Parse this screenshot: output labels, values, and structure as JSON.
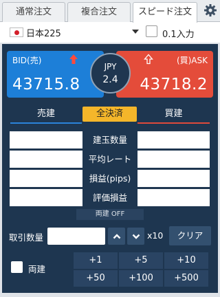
{
  "tabs": [
    {
      "label": "通常注文"
    },
    {
      "label": "複合注文"
    },
    {
      "label": "スピード注文"
    }
  ],
  "settings_icon": "gear-icon",
  "symbol": {
    "flag_icon": "japan-flag-icon",
    "name": "日本225",
    "lot_label": "0.1入力"
  },
  "quote": {
    "bid_label": "BID(売)",
    "bid_price": "43715.8",
    "ask_label": "(買)ASK",
    "ask_price": "43718.2",
    "spread_currency": "JPY",
    "spread_value": "2.4",
    "bid_color": "#1d7fd8",
    "ask_color": "#e44c3a"
  },
  "position": {
    "sell_header": "売建",
    "close_all_label": "全決済",
    "buy_header": "買建",
    "rows": [
      {
        "label": "建玉数量"
      },
      {
        "label": "平均レート"
      },
      {
        "label": "損益(pips)"
      },
      {
        "label": "評価損益"
      }
    ],
    "hedge_status": "両建 OFF"
  },
  "order": {
    "qty_label": "取引数量",
    "qty_value": "",
    "multiplier_label": "x10",
    "clear_label": "クリア",
    "hedge_label": "両建",
    "quick_add": [
      "+1",
      "+5",
      "+10",
      "+50",
      "+100",
      "+500"
    ]
  }
}
